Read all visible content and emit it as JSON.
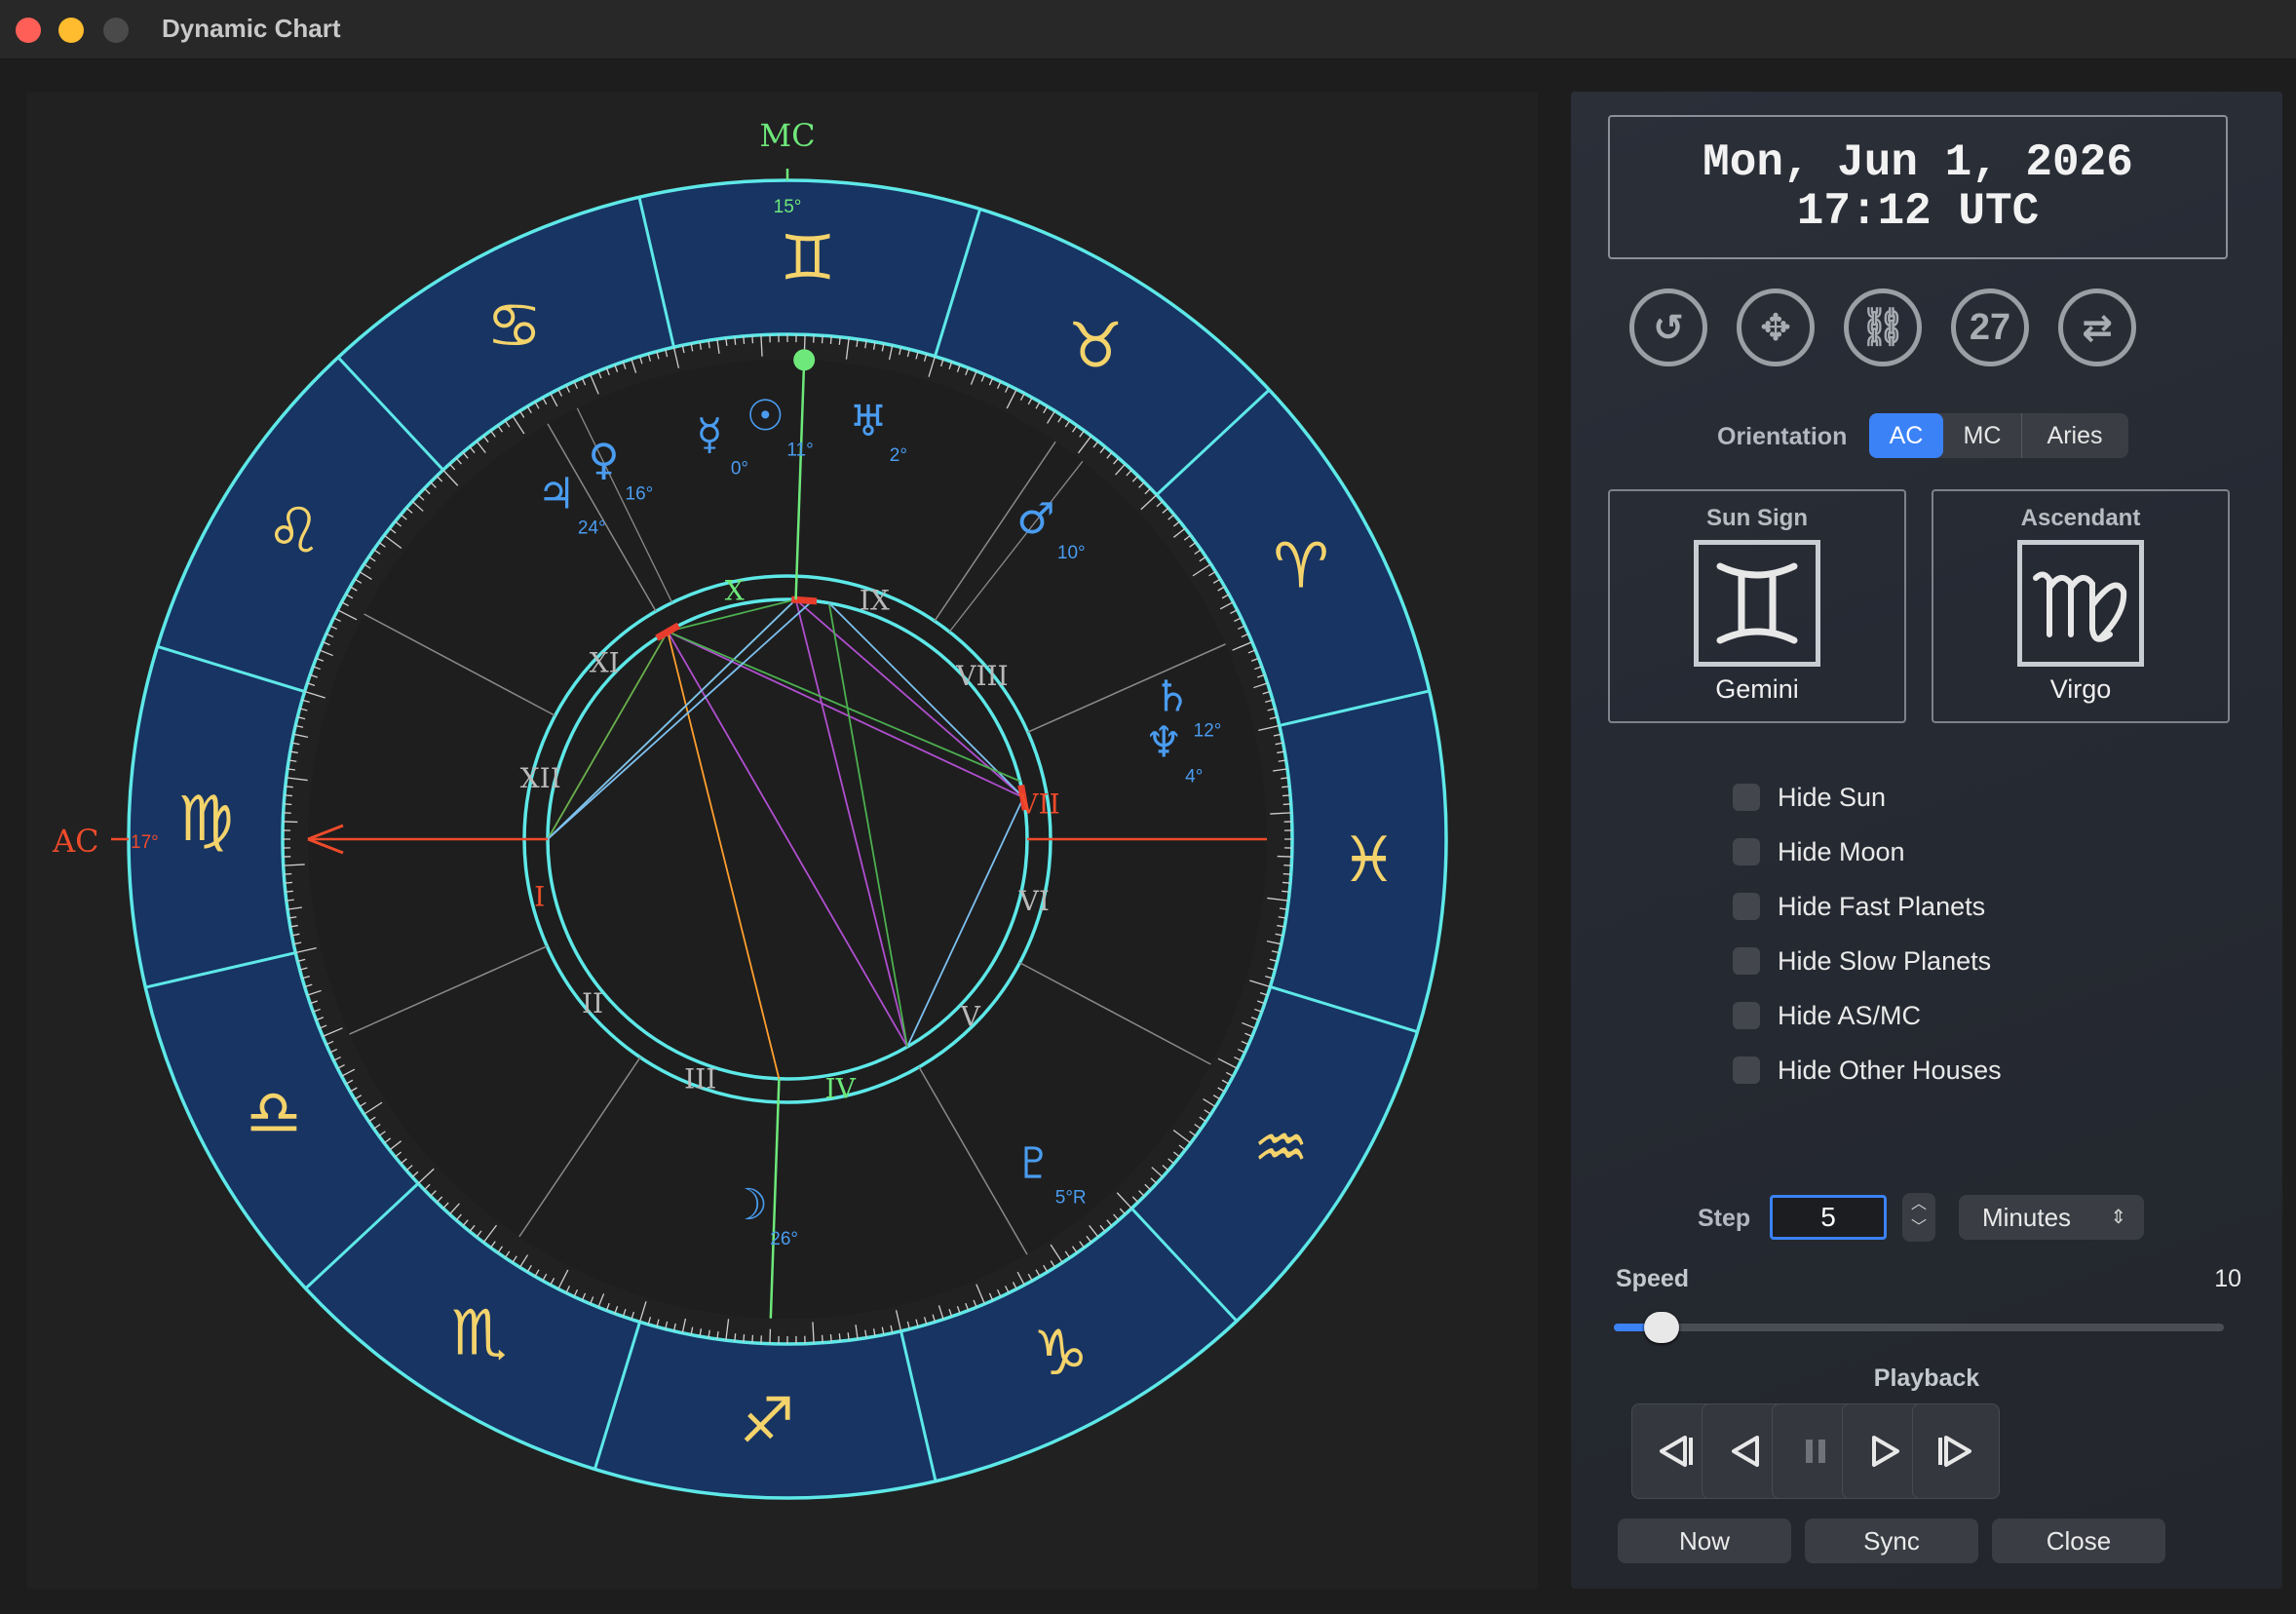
{
  "window": {
    "title": "Dynamic Chart"
  },
  "chart": {
    "mc_label": "MC",
    "mc_degree": "15°",
    "ac_label": "AC",
    "ac_degree": "17°",
    "houses": [
      "I",
      "II",
      "III",
      "IV",
      "V",
      "VI",
      "VII",
      "VIII",
      "IX",
      "X",
      "XI",
      "XII"
    ],
    "zodiac": [
      {
        "glyph": "♊",
        "name": "gemini-sign"
      },
      {
        "glyph": "♉",
        "name": "taurus-sign"
      },
      {
        "glyph": "♈",
        "name": "aries-sign"
      },
      {
        "glyph": "♓",
        "name": "pisces-sign"
      },
      {
        "glyph": "♒",
        "name": "aquarius-sign"
      },
      {
        "glyph": "♑",
        "name": "capricorn-sign"
      },
      {
        "glyph": "♐",
        "name": "sagittarius-sign"
      },
      {
        "glyph": "♏",
        "name": "scorpio-sign"
      },
      {
        "glyph": "♎",
        "name": "libra-sign"
      },
      {
        "glyph": "♍",
        "name": "virgo-sign"
      },
      {
        "glyph": "♌",
        "name": "leo-sign"
      },
      {
        "glyph": "♋",
        "name": "cancer-sign"
      }
    ],
    "planets": [
      {
        "glyph": "☿",
        "degree": "0°",
        "name": "mercury"
      },
      {
        "glyph": "☉",
        "degree": "11°",
        "name": "sun"
      },
      {
        "glyph": "♅",
        "degree": "2°",
        "name": "uranus"
      },
      {
        "glyph": "♀",
        "degree": "16°",
        "name": "venus"
      },
      {
        "glyph": "♃",
        "degree": "24°",
        "name": "jupiter"
      },
      {
        "glyph": "♂",
        "degree": "10°",
        "name": "mars"
      },
      {
        "glyph": "♄",
        "degree": "12°",
        "name": "saturn"
      },
      {
        "glyph": "♆",
        "degree": "4°",
        "name": "neptune"
      },
      {
        "glyph": "♇",
        "degree": "5°R",
        "name": "pluto"
      },
      {
        "glyph": "☽",
        "degree": "26°",
        "name": "moon"
      }
    ]
  },
  "panel": {
    "date_line1": "Mon, Jun 1, 2026",
    "date_line2": "17:12 UTC",
    "tools": [
      {
        "name": "reset-icon",
        "glyph": "↺"
      },
      {
        "name": "move-icon",
        "glyph": "✥"
      },
      {
        "name": "link-icon",
        "glyph": "⛓"
      },
      {
        "name": "calendar-day-icon",
        "glyph": "27"
      },
      {
        "name": "sync-icon",
        "glyph": "⇄"
      }
    ],
    "orientation_label": "Orientation",
    "orientation_options": [
      "AC",
      "MC",
      "Aries"
    ],
    "orientation_selected": "AC",
    "sun_sign": {
      "caption": "Sun Sign",
      "glyph": "♊",
      "name": "Gemini"
    },
    "ascendant": {
      "caption": "Ascendant",
      "glyph": "♍",
      "name": "Virgo"
    },
    "checkboxes": [
      "Hide Sun",
      "Hide Moon",
      "Hide Fast Planets",
      "Hide Slow Planets",
      "Hide AS/MC",
      "Hide Other Houses"
    ],
    "step_label": "Step",
    "step_value": "5",
    "step_unit": "Minutes",
    "speed_label": "Speed",
    "speed_value": "10",
    "speed_fraction": 0.05,
    "playback_label": "Playback",
    "actions": [
      "Now",
      "Sync",
      "Close"
    ]
  },
  "colors": {
    "ring": "#5ee8e8",
    "ring_fill": "#173463",
    "zodiac_glyph": "#f4d36b",
    "planet": "#4a9cf0",
    "mc": "#6ee87a",
    "ac": "#ee4b2b",
    "accent": "#3b82f6"
  }
}
